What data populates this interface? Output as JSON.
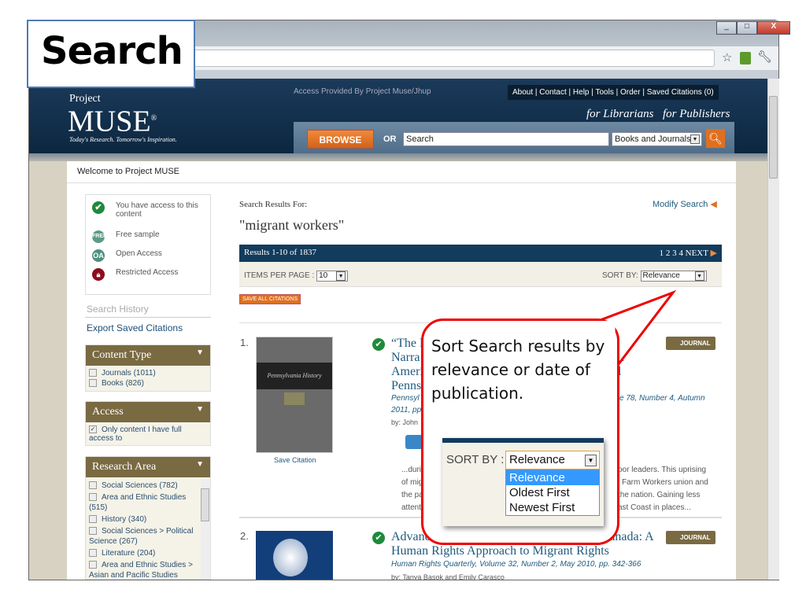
{
  "label": "Search",
  "browser": {
    "win_min": "_",
    "win_max": "□",
    "win_close": "X"
  },
  "header": {
    "logo_top": "Project",
    "logo_main": "MUSE",
    "logo_reg": "®",
    "tagline": "Today's Research. Tomorrow's Inspiration.",
    "access": "Access Provided By Project Muse/Jhup",
    "nav": [
      "About",
      "Contact",
      "Help",
      "Tools",
      "Order",
      "Saved Citations (0)"
    ],
    "for_librarians": "for Librarians",
    "for_publishers": "for Publishers",
    "browse": "BROWSE",
    "or": "OR",
    "search_value": "Search",
    "scope": "Books and Journals"
  },
  "welcome": "Welcome to Project MUSE",
  "legend": [
    "You have access to this content",
    "Free sample",
    "Open Access",
    "Restricted Access"
  ],
  "legend_icons": [
    "FREE",
    "OA"
  ],
  "search_history": "Search History",
  "export": "Export Saved Citations",
  "facets": {
    "content_type": {
      "title": "Content Type",
      "items": [
        "Journals  (1011)",
        "Books  (826)"
      ]
    },
    "access": {
      "title": "Access",
      "items": [
        "Only content I have full access to"
      ]
    },
    "research_area": {
      "title": "Research Area",
      "items": [
        "Social Sciences (782)",
        "Area and Ethnic Studies (515)",
        "History (340)",
        "Social Sciences > Political Science (267)",
        "Literature (204)",
        "Area and Ethnic Studies > Asian and Pacific Studies (146)"
      ]
    }
  },
  "results": {
    "for_label": "Search Results For:",
    "query": "\"migrant workers\"",
    "modify": "Modify Search",
    "count": "Results 1-10 of 1837",
    "pages": [
      "1",
      "2",
      "3",
      "4"
    ],
    "next": "NEXT",
    "ipp_label": "ITEMS PER PAGE :",
    "ipp": "10",
    "sort_label": "SORT BY:",
    "sort": "Relevance",
    "save_all": "SAVE ALL CITATIONS",
    "item1": {
      "num": "1.",
      "frag": [
        "“The F",
        "Narra",
        "Ameri",
        "Penns"
      ],
      "title_right": [
        "T:",
        "n",
        "l"
      ],
      "meta_left": "Pennsyl",
      "meta_right": "e 78, Number 4, Autumn",
      "meta2": "2011, pp",
      "by": "by: John",
      "save": "Save Citation",
      "badge": "JOURNAL",
      "cover": "Pennsylvania History",
      "snip_left": [
        "...duri",
        "of mig",
        "the pa",
        "attenti"
      ],
      "snip_right": [
        "oor leaders. This uprising",
        "l Farm Workers union and",
        "the nation. Gaining less",
        "ast Coast in places..."
      ]
    },
    "item2": {
      "num": "2.",
      "title": "Advancing the Rights of Non-Citizens in Canada: A Human Rights Approach to Migrant Rights",
      "meta": "Human Rights Quarterly, Volume 32, Number 2, May 2010, pp. 342-366",
      "by": "by: Tanya Basok and Emily Carasco",
      "badge": "JOURNAL"
    }
  },
  "callout": {
    "text": "Sort Search results by relevance or date of publication.",
    "sort_label": "SORT BY :",
    "selected": "Relevance",
    "options": [
      "Relevance",
      "Oldest First",
      "Newest First"
    ]
  },
  "colors": {
    "accent": "#e00000",
    "navy": "#123b5c",
    "olive": "#7a6a42",
    "orange": "#e0701f"
  }
}
